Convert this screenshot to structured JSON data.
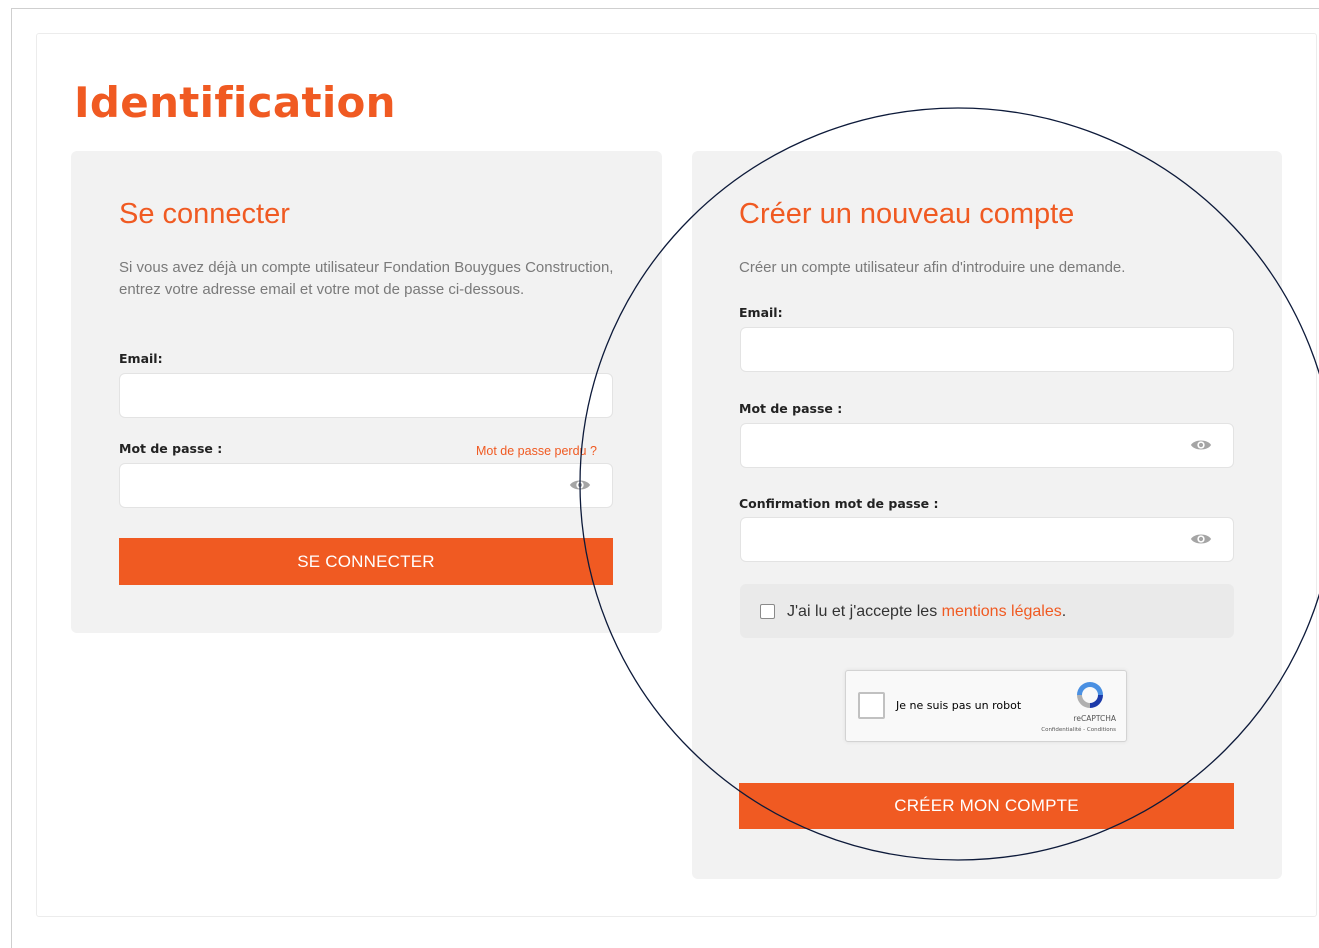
{
  "page": {
    "title": "Identification"
  },
  "login": {
    "title": "Se connecter",
    "description": "Si vous avez déjà un compte utilisateur Fondation Bouygues Construction, entrez votre adresse email et votre mot de passe ci-dessous.",
    "email_label": "Email:",
    "email_value": "",
    "password_label": "Mot de passe :",
    "password_value": "",
    "forgot_password_link": "Mot de passe perdu ?",
    "submit_label": "SE CONNECTER"
  },
  "register": {
    "title": "Créer un nouveau compte",
    "description": "Créer un compte utilisateur afin d'introduire une demande.",
    "email_label": "Email:",
    "email_value": "",
    "password_label": "Mot de passe :",
    "password_value": "",
    "confirm_password_label": "Confirmation mot de passe :",
    "confirm_password_value": "",
    "terms_prefix": "J'ai lu et j'accepte les ",
    "terms_link": "mentions légales",
    "terms_suffix": ".",
    "terms_checked": false,
    "submit_label": "CRÉER MON COMPTE"
  },
  "recaptcha": {
    "label": "Je ne suis pas un robot",
    "brand": "reCAPTCHA",
    "legal": "Confidentialité - Conditions",
    "checked": false
  },
  "icons": {
    "eye": "eye-icon",
    "recaptcha_logo": "recaptcha-logo-icon"
  },
  "colors": {
    "accent": "#f05a22",
    "panel_background": "#f2f2f2",
    "annotation_stroke": "#0d1a3a"
  }
}
